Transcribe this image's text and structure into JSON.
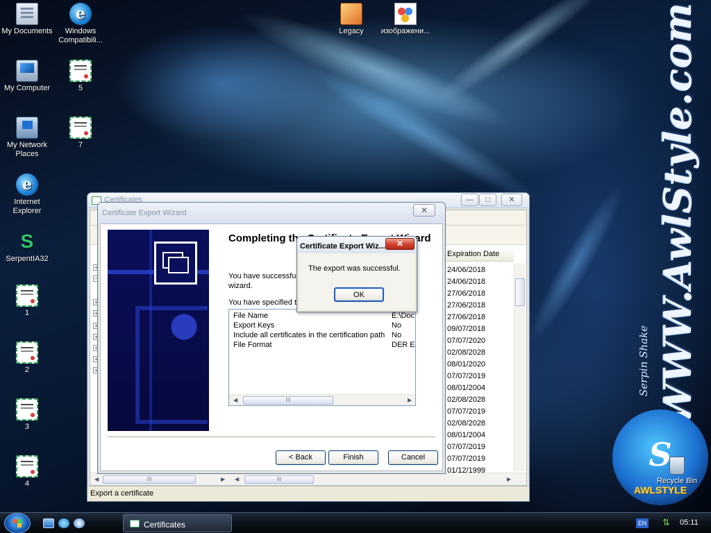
{
  "desktop": {
    "icons": [
      {
        "label": "My Documents",
        "icon": "folder-icon"
      },
      {
        "label": "Windows Compatibili...",
        "icon": "ie-icon"
      },
      {
        "label": "Legacy",
        "icon": "legacy-app-icon"
      },
      {
        "label": "изображени...",
        "icon": "image-icon"
      },
      {
        "label": "My Computer",
        "icon": "computer-icon"
      },
      {
        "label": "5",
        "icon": "certificate-file-icon"
      },
      {
        "label": "My Network Places",
        "icon": "network-icon"
      },
      {
        "label": "7",
        "icon": "certificate-file-icon"
      },
      {
        "label": "Internet Explorer",
        "icon": "ie-icon"
      },
      {
        "label": "SerpentIA32",
        "icon": "serpent-icon"
      },
      {
        "label": "1",
        "icon": "certificate-file-icon"
      },
      {
        "label": "2",
        "icon": "certificate-file-icon"
      },
      {
        "label": "3",
        "icon": "certificate-file-icon"
      },
      {
        "label": "4",
        "icon": "certificate-file-icon"
      },
      {
        "label": "Recycle Bin",
        "icon": "recycle-bin-icon"
      }
    ],
    "wallpaper": {
      "brand_url": "WWW.AwlStyle.com",
      "brand_author": "Serpin Shake",
      "brand_logo": "AWLSTYLE"
    }
  },
  "certificates_window": {
    "title": "Certificates",
    "column_header": "Expiration Date",
    "expiration_dates": [
      "24/06/2018",
      "24/06/2018",
      "27/06/2018",
      "27/06/2018",
      "27/06/2018",
      "09/07/2018",
      "07/07/2020",
      "02/08/2028",
      "08/01/2020",
      "07/07/2019",
      "08/01/2004",
      "02/08/2028",
      "07/07/2019",
      "02/08/2028",
      "08/01/2004",
      "07/07/2019",
      "07/07/2019",
      "01/12/1999"
    ],
    "scroll_grip": "III",
    "status_text": "Export a certificate"
  },
  "wizard": {
    "title": "Certificate Export Wizard",
    "heading": "Completing the Certificate Export Wizard",
    "intro_line1": "You have successfully completed the Certificate Export",
    "intro_line2": "wizard.",
    "specified_line": "You have specified the following settings:",
    "summary": [
      {
        "name": "File Name",
        "value": "E:\\Doc"
      },
      {
        "name": "Export Keys",
        "value": "No"
      },
      {
        "name": "Include all certificates in the certification path",
        "value": "No"
      },
      {
        "name": "File Format",
        "value": "DER En"
      }
    ],
    "scroll_grip": "III",
    "back_label": "< Back",
    "finish_label": "Finish",
    "cancel_label": "Cancel"
  },
  "message_box": {
    "title": "Certificate Export Wiz...",
    "message": "The export was successful.",
    "ok_label": "OK"
  },
  "taskbar": {
    "task_label": "Certificates",
    "language": "EN",
    "clock": "05:11"
  },
  "colors": {
    "taskbar": "#0c121b",
    "close_button": "#d0402c",
    "wizard_banner": "#0a0f5c"
  }
}
